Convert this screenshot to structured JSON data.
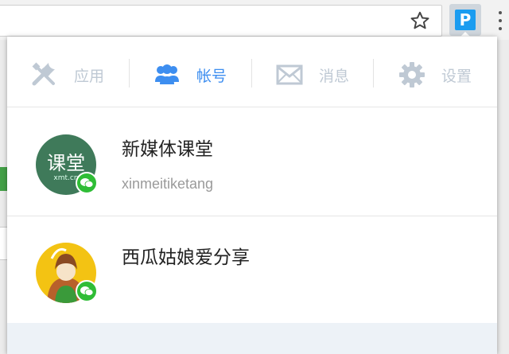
{
  "browser": {
    "bookmark_icon": "star-icon",
    "extension_label": "P",
    "menu_icon": "vertical-dots-icon"
  },
  "tabs": [
    {
      "label": "应用",
      "icon": "tools-icon",
      "active": false
    },
    {
      "label": "帐号",
      "icon": "users-icon",
      "active": true
    },
    {
      "label": "消息",
      "icon": "envelope-icon",
      "active": false
    },
    {
      "label": "设置",
      "icon": "gear-icon",
      "active": false
    }
  ],
  "accounts": [
    {
      "name": "新媒体课堂",
      "id": "xinmeitiketang",
      "avatar_text": "课堂",
      "avatar_subtext": "xmt.cn",
      "badge_icon": "wechat-icon"
    },
    {
      "name": "西瓜姑娘爱分享",
      "id": "",
      "badge_icon": "wechat-icon"
    }
  ],
  "colors": {
    "accent": "#3d8ef0",
    "inactive": "#bfc9d4",
    "wechat_green": "#2fbd36",
    "extension_blue": "#1a9cf0"
  }
}
